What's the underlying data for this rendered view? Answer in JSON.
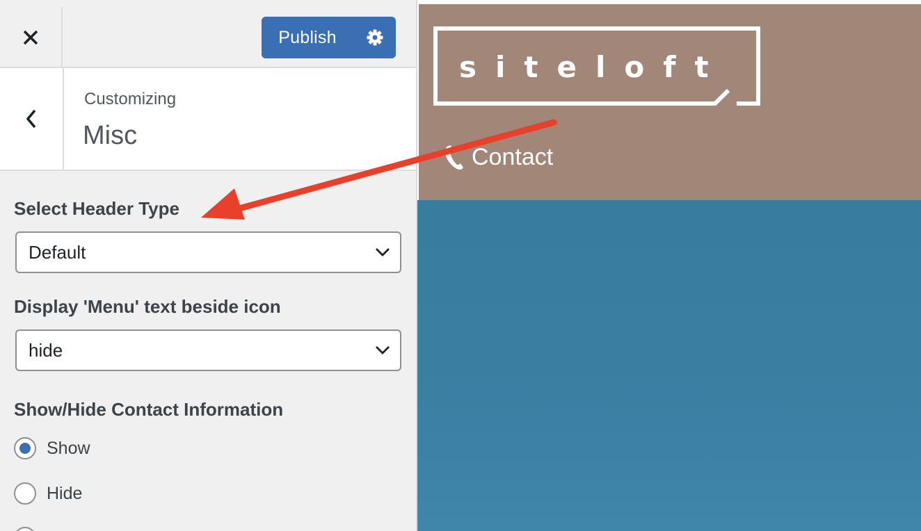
{
  "header": {
    "close_icon": "close-icon",
    "publish_label": "Publish",
    "gear_icon": "gear-icon"
  },
  "section": {
    "back_icon": "chevron-left-icon",
    "breadcrumb": "Customizing",
    "title": "Misc"
  },
  "controls": {
    "header_type": {
      "label": "Select Header Type",
      "value": "Default"
    },
    "menu_text": {
      "label": "Display 'Menu' text beside icon",
      "value": "hide"
    },
    "contact_info": {
      "label": "Show/Hide Contact Information",
      "options": [
        {
          "label": "Show",
          "selected": true
        },
        {
          "label": "Hide",
          "selected": false
        }
      ]
    }
  },
  "preview": {
    "logo_text": "siteloft",
    "contact_label": "Contact",
    "phone_icon": "phone-icon",
    "header_color": "#a28677",
    "hero_color": "#3a7ea2"
  },
  "colors": {
    "accent": "#3a6fb3",
    "annotation_arrow": "#e8402a"
  }
}
